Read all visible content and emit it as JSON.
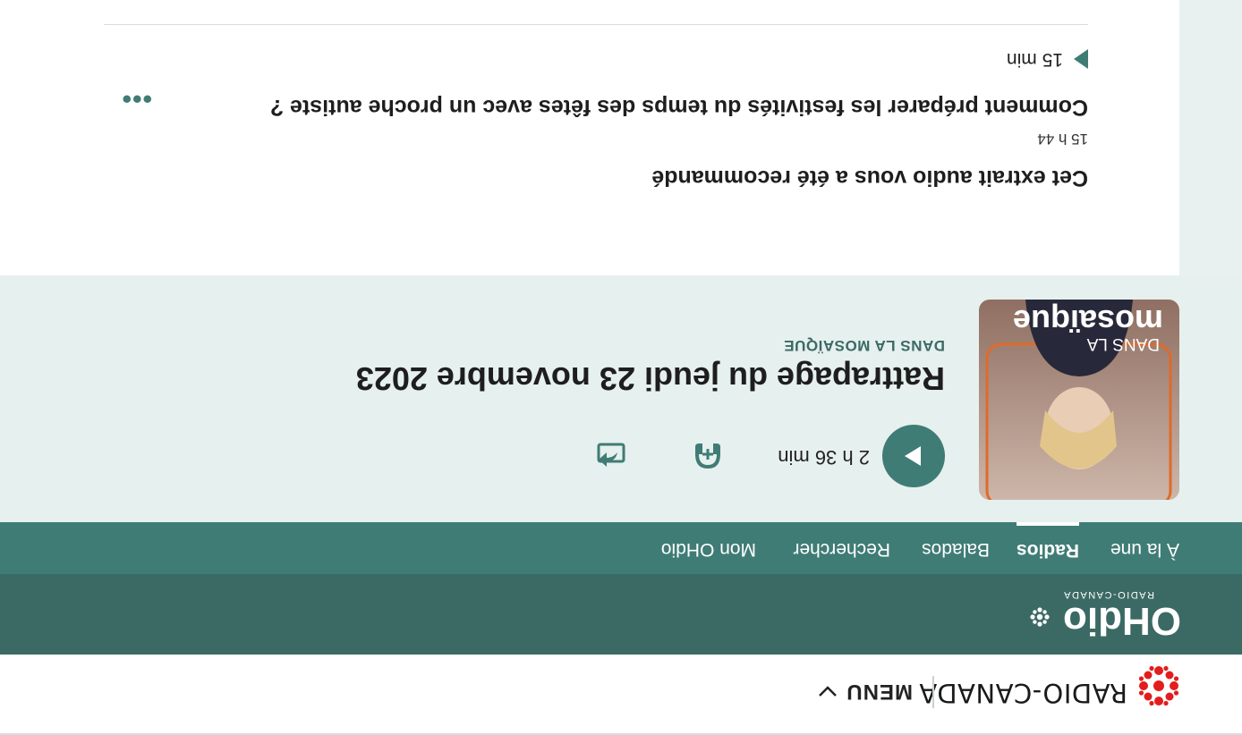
{
  "site_bar": {
    "brand": "RADIO-CANADA",
    "menu_label": "MENU",
    "colors": {
      "logo_red": "#e31d1d"
    }
  },
  "brand_bar": {
    "logo_text": "OHdio",
    "logo_subtext": "RADIO-CANADA",
    "colors": {
      "bg": "#3b6a64"
    }
  },
  "nav": {
    "items": [
      {
        "label": "À la une"
      },
      {
        "label": "Radios",
        "active": true
      },
      {
        "label": "Balados"
      },
      {
        "label": "Rechercher"
      },
      {
        "label": "Mon OHdio"
      }
    ],
    "colors": {
      "bg": "#3f7c75"
    }
  },
  "player": {
    "cover_title_small": "DANS LA",
    "cover_title_big": "mosaïque",
    "show_label": "DANS LA MOSAÏQUE",
    "episode_title": "Rattrapage du jeudi 23 novembre 2023",
    "duration": "2 h 36 min",
    "icons": [
      "play-icon",
      "add-to-list-icon",
      "share-icon"
    ]
  },
  "recommendation": {
    "heading": "Cet extrait audio vous a été recommandé",
    "time": "15 h 44",
    "episode_title": "Comment préparer les festivités du temps des fêtes avec un proche autiste ?",
    "duration": "15 min",
    "more_label": "•••"
  }
}
